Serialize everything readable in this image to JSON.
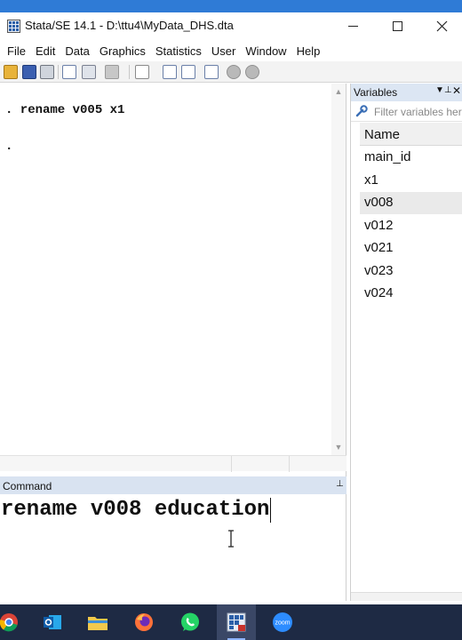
{
  "window": {
    "title": "Stata/SE 14.1 - D:\\ttu4\\MyData_DHS.dta"
  },
  "menu": {
    "items": [
      "File",
      "Edit",
      "Data",
      "Graphics",
      "Statistics",
      "User",
      "Window",
      "Help"
    ]
  },
  "toolbar": {
    "icons": [
      "open-icon",
      "save-icon",
      "print-icon",
      "log-icon",
      "viewer-icon",
      "graph-icon",
      "do-file-editor-icon",
      "data-editor-icon",
      "data-browser-icon",
      "variables-manager-icon",
      "more-icon",
      "break-icon"
    ]
  },
  "results": {
    "lines": [
      ". rename v005 x1",
      "."
    ]
  },
  "variables": {
    "title": "Variables",
    "filter_placeholder": "Filter variables here",
    "column_header": "Name",
    "items": [
      "main_id",
      "x1",
      "v008",
      "v012",
      "v021",
      "v023",
      "v024"
    ],
    "selected": "v008"
  },
  "command": {
    "title": "Command",
    "input_value": "rename v008 education"
  },
  "taskbar": {
    "apps": [
      "chrome-icon",
      "outlook-icon",
      "file-explorer-icon",
      "firefox-icon",
      "whatsapp-icon",
      "stata-icon",
      "zoom-icon"
    ],
    "zoom_label": "zoom",
    "colors": {
      "background": "#1e2a44",
      "active": "#3a4766"
    }
  }
}
